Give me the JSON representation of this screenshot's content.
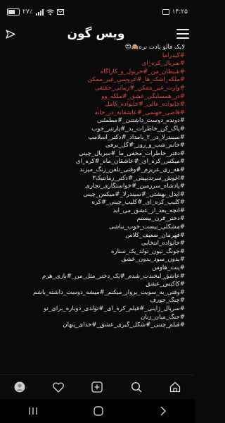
{
  "status": {
    "time": "۱۴:۲۵",
    "battery": "۲۷٪"
  },
  "header": {
    "logo_text": "ویس گون"
  },
  "post": {
    "lines": [
      {
        "text": "لایک فالو یادت نره🙈😍",
        "red": false
      },
      {
        "text": "#کیدراما",
        "red": true
      },
      {
        "text": "#سریال_کره_ای",
        "red": true
      },
      {
        "text": "#شیطان_من_#خریول_و_کاراگاه",
        "red": true
      },
      {
        "text": "#ملکه_اشک_ها_#عروسی_غیر_ممکن",
        "red": true
      },
      {
        "text": "#وارث_غیر_ممکن_#زیبایی_حقیقی",
        "red": true
      },
      {
        "text": "#در_همسایگی_عشق_#ملکه_وو",
        "red": true
      },
      {
        "text": "#خانواده_عالی_#خانواده_کامل",
        "red": true
      },
      {
        "text": "#قاضی_جهنمی_#عاشقانه_در_خانه",
        "red": true
      },
      {
        "text": "#دونده_دوست_داشتنی_#مطمئنی",
        "red": false
      },
      {
        "text": "#پاک_کن_خاطرات_بد_#پارتنر_خوب",
        "red": false
      },
      {
        "text": "#سیندرلا_در_۲_بامداد_#دکتر_اسلامپ",
        "red": false
      },
      {
        "text": "#خانم_شب_و_روز_#گل_برفی",
        "red": false
      },
      {
        "text": "#دفتر_خاطرات_مخفی_ما_#سریال_چینی",
        "red": false
      },
      {
        "text": "#میکس_کره_ای_#عاشقان_ماه_#کره_ای",
        "red": false
      },
      {
        "text": "#هه_ری_عزیزم_#وقتی_تلفن_زنگ_میزند",
        "red": false
      },
      {
        "text": "#آغوش_سرندیپیتی_#دکتر_رمانتیک۳",
        "red": false
      },
      {
        "text": "#پادشاه_سرزمین_#خواستگاری_تجاری",
        "red": false
      },
      {
        "text": "#آیدل_بهشتی_#سیندرلا_#میکس_چینی",
        "red": false
      },
      {
        "text": "#کلیپ_کره_ای_#کلیپ_چینی_#کره",
        "red": false
      },
      {
        "text": "#آنچه_بعد_از_عشق_می_آید",
        "red": false
      },
      {
        "text": "#دختر_قرن_بیستم",
        "red": false
      },
      {
        "text": "#مشکلی_نیست_خوب_نباشی",
        "red": false
      },
      {
        "text": "#قهرمان_ضعیف_کلاس",
        "red": false
      },
      {
        "text": "#خانواده_انتخابی",
        "red": false
      },
      {
        "text": "#جونگ_نیون_تولد_یک_ستاره",
        "red": false
      },
      {
        "text": "#بدون_سود_بدون_عشق",
        "red": false
      },
      {
        "text": "#پنت_هاوس",
        "red": false
      },
      {
        "text": "#عاشق_لبخندت_شدم_#یک_دختر_مثل_من_#بازی_هرم",
        "red": false
      },
      {
        "text": "#کاکتس_عشق",
        "red": false
      },
      {
        "text": "#وقتی_به_سویت_پرواز_میکنم_#میشه_دوست_داشته_باشم",
        "red": false
      },
      {
        "text": "#چنگ_جورف",
        "red": false
      },
      {
        "text": "#سریال_ژاپنی_#فیلم_کره_ای_#تولدی_دوباره_برای_تو",
        "red": false
      },
      {
        "text": "#جنگ_میان_زنان",
        "red": false
      },
      {
        "text": "#فیلم_چینی_#شکل_گیری_عشق_#خدای_پنهان",
        "red": false
      }
    ]
  },
  "tabs": [
    {
      "name": "home-icon"
    },
    {
      "name": "search-icon"
    },
    {
      "name": "add-icon"
    },
    {
      "name": "heart-icon"
    },
    {
      "name": "profile-avatar"
    }
  ],
  "colors": {
    "background": "#0a0a0a",
    "hashtag_red": "#e0483e",
    "text": "#e8e8e8"
  }
}
